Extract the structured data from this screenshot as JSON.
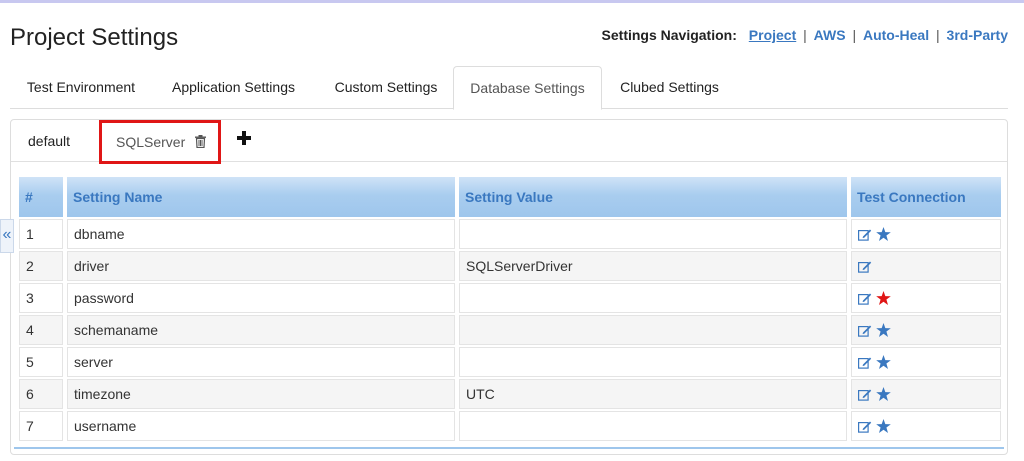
{
  "header": {
    "title": "Project Settings",
    "nav_label": "Settings Navigation:",
    "nav_links": [
      "Project",
      "AWS",
      "Auto-Heal",
      "3rd-Party"
    ],
    "nav_separator": "|"
  },
  "main_tabs": [
    "Test Environment",
    "Application Settings",
    "Custom Settings",
    "Database Settings",
    "Clubed Settings"
  ],
  "active_main_tab": "Database Settings",
  "db_tabs": {
    "default": "default",
    "selected": "SQLServer",
    "add_label": "+"
  },
  "table": {
    "columns": [
      "#",
      "Setting Name",
      "Setting Value",
      "Test Connection"
    ],
    "rows": [
      {
        "num": "1",
        "name": "dbname",
        "value": "",
        "star": "blue"
      },
      {
        "num": "2",
        "name": "driver",
        "value": "SQLServerDriver",
        "star": "none"
      },
      {
        "num": "3",
        "name": "password",
        "value": "",
        "star": "red"
      },
      {
        "num": "4",
        "name": "schemaname",
        "value": "",
        "star": "blue"
      },
      {
        "num": "5",
        "name": "server",
        "value": "",
        "star": "blue"
      },
      {
        "num": "6",
        "name": "timezone",
        "value": "UTC",
        "star": "blue"
      },
      {
        "num": "7",
        "name": "username",
        "value": "",
        "star": "blue"
      }
    ]
  },
  "colors": {
    "link": "#3a78c0",
    "highlight_border": "#e01616",
    "star_blue": "#3a78c0",
    "star_red": "#e01616"
  },
  "icons": {
    "edit": "edit-icon",
    "star": "star-icon",
    "trash": "trash-icon",
    "plus": "plus-icon",
    "collapse": "double-chevron-left-icon"
  },
  "collapse_glyph": "«"
}
